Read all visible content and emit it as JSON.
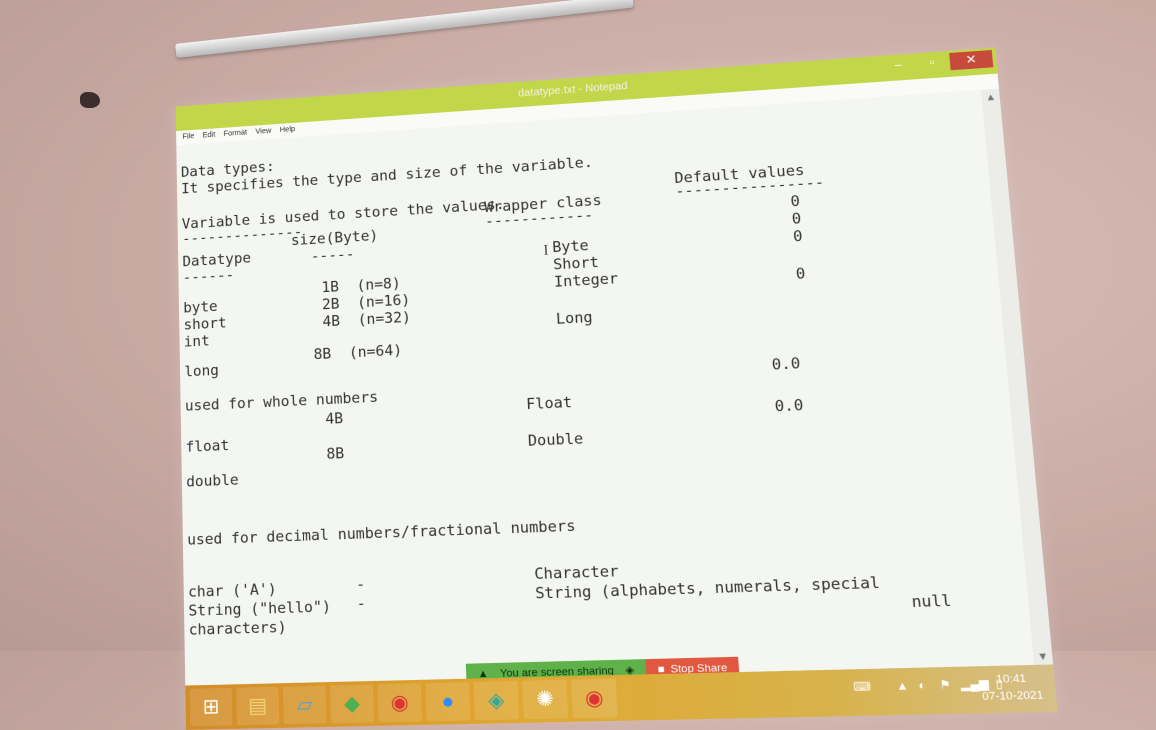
{
  "window": {
    "title": "datatype.txt - Notepad",
    "controls": {
      "minimize": "–",
      "maximize": "▫",
      "close": "✕"
    }
  },
  "menu": [
    "File",
    "Edit",
    "Format",
    "View",
    "Help"
  ],
  "document": {
    "lines": [
      "Data types:",
      "It specifies the type and size of the variable.",
      "Variable is used to store the values.",
      "--------------",
      "Datatype",
      "------",
      "size(Byte)",
      "-----",
      "Wrapper class",
      "------------",
      "Default values",
      "----------------",
      "byte",
      "short",
      "int",
      "long",
      "1B  (n=8)",
      "2B  (n=16)",
      "4B  (n=32)",
      "8B  (n=64)",
      "Byte",
      "Short",
      "Integer",
      "Long",
      "0",
      "0",
      "0",
      "0",
      "used for whole numbers",
      "float",
      "double",
      "4B",
      "8B",
      "Float",
      "Double",
      "0.0",
      "0.0",
      "used for decimal numbers/fractional numbers",
      "char ('A')",
      "String (\"hello\")",
      "characters)",
      "-",
      "-",
      "Character",
      "String (alphabets, numerals, special",
      "null"
    ]
  },
  "screen_share": {
    "message": "You are screen sharing",
    "stop_label": "Stop Share"
  },
  "taskbar": {
    "apps": [
      "windows-start",
      "file-explorer",
      "notepad",
      "app-launcher",
      "chrome",
      "zoom",
      "app-tile",
      "media-player",
      "chrome"
    ],
    "clock_time": "10:41",
    "clock_date": "07-10-2021"
  }
}
